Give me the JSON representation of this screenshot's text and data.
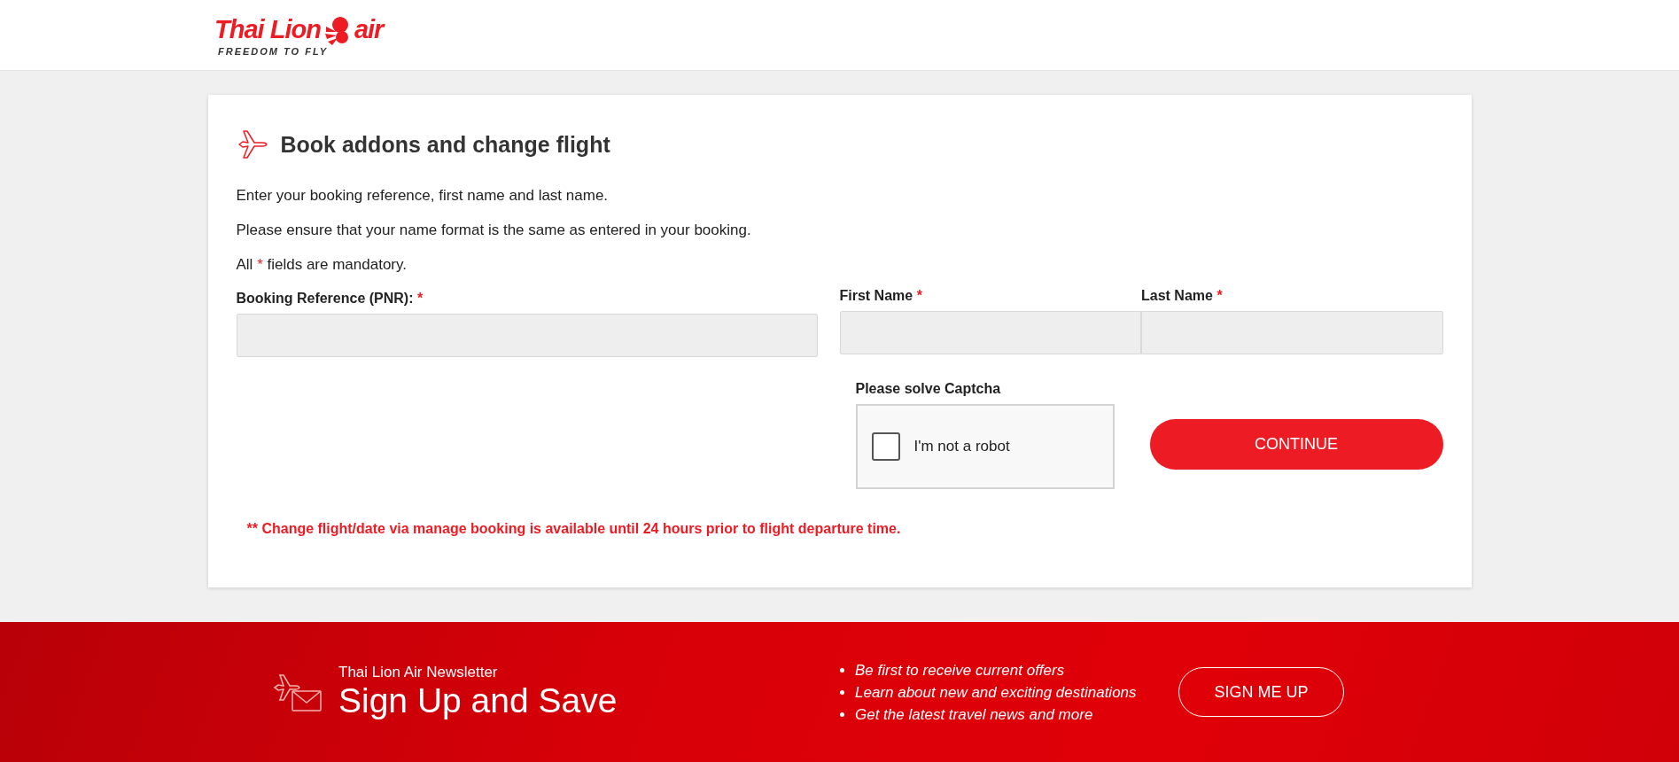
{
  "header": {
    "logo": {
      "brand": "Thai Lion",
      "suffix": "air",
      "tagline": "FREEDOM TO FLY"
    }
  },
  "form": {
    "title": "Book addons and change flight",
    "instructions": [
      "Enter your booking reference, first name and last name.",
      "Please ensure that your name format is the same as entered in your booking."
    ],
    "mandatory_note": {
      "before": "All",
      "mark": "*",
      "after": "fields are mandatory."
    },
    "fields": [
      {
        "label": "Booking Reference (PNR):",
        "required_mark": "*"
      },
      {
        "label": "First Name",
        "required_mark": "*"
      },
      {
        "label": "Last Name",
        "required_mark": "*"
      }
    ],
    "captcha": {
      "label": "Please solve Captcha",
      "text": "I'm not a robot",
      "checked": false
    },
    "continue_button": "CONTINUE",
    "notice": "** Change flight/date via manage booking is available until 24 hours prior to flight departure time."
  },
  "newsletter": {
    "eyebrow": "Thai Lion Air Newsletter",
    "title": "Sign Up and Save",
    "benefits": [
      "Be first to receive current offers",
      "Learn about new and exciting destinations",
      "Get the latest travel news and more"
    ],
    "button": "SIGN ME UP"
  }
}
